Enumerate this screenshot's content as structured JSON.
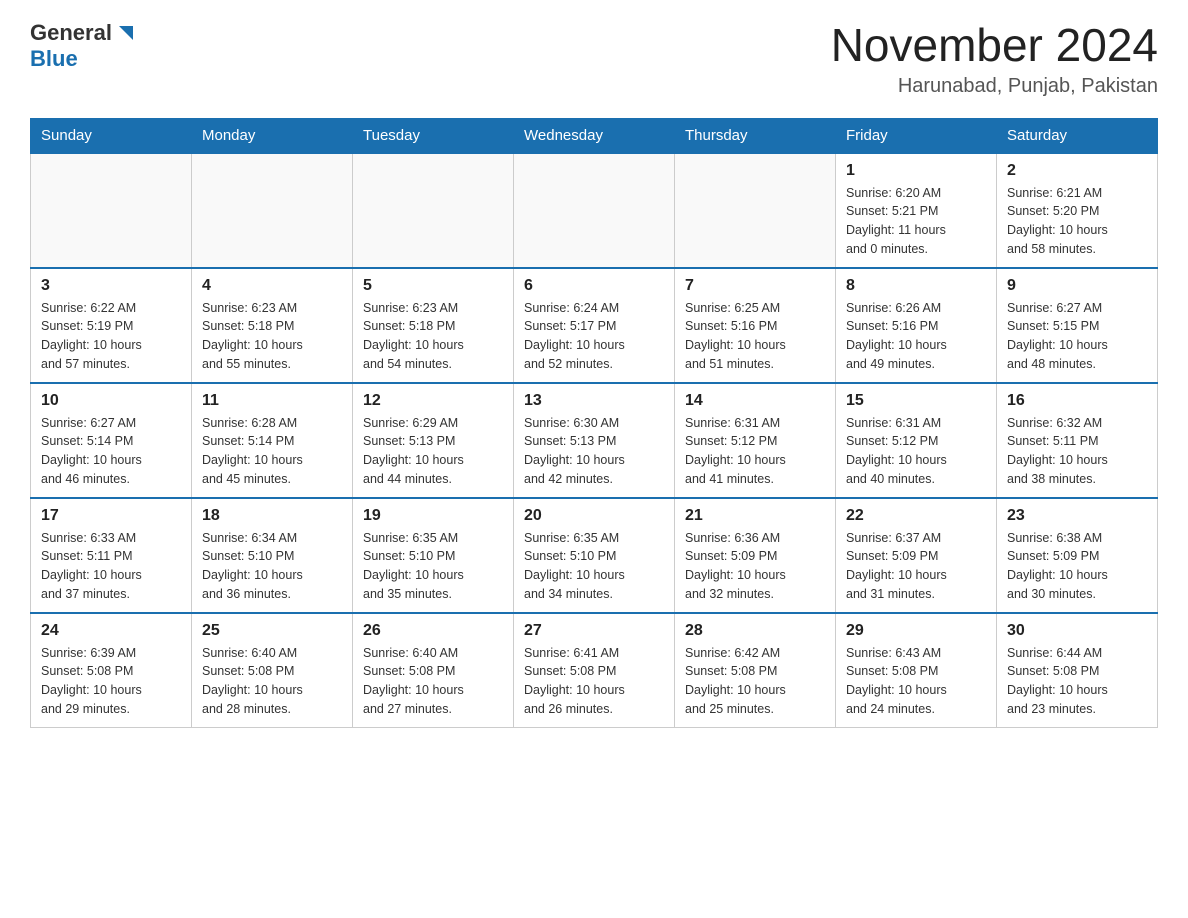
{
  "header": {
    "logo_general": "General",
    "logo_blue": "Blue",
    "month_title": "November 2024",
    "location": "Harunabad, Punjab, Pakistan"
  },
  "days_of_week": [
    "Sunday",
    "Monday",
    "Tuesday",
    "Wednesday",
    "Thursday",
    "Friday",
    "Saturday"
  ],
  "weeks": [
    [
      {
        "day": "",
        "info": ""
      },
      {
        "day": "",
        "info": ""
      },
      {
        "day": "",
        "info": ""
      },
      {
        "day": "",
        "info": ""
      },
      {
        "day": "",
        "info": ""
      },
      {
        "day": "1",
        "info": "Sunrise: 6:20 AM\nSunset: 5:21 PM\nDaylight: 11 hours\nand 0 minutes."
      },
      {
        "day": "2",
        "info": "Sunrise: 6:21 AM\nSunset: 5:20 PM\nDaylight: 10 hours\nand 58 minutes."
      }
    ],
    [
      {
        "day": "3",
        "info": "Sunrise: 6:22 AM\nSunset: 5:19 PM\nDaylight: 10 hours\nand 57 minutes."
      },
      {
        "day": "4",
        "info": "Sunrise: 6:23 AM\nSunset: 5:18 PM\nDaylight: 10 hours\nand 55 minutes."
      },
      {
        "day": "5",
        "info": "Sunrise: 6:23 AM\nSunset: 5:18 PM\nDaylight: 10 hours\nand 54 minutes."
      },
      {
        "day": "6",
        "info": "Sunrise: 6:24 AM\nSunset: 5:17 PM\nDaylight: 10 hours\nand 52 minutes."
      },
      {
        "day": "7",
        "info": "Sunrise: 6:25 AM\nSunset: 5:16 PM\nDaylight: 10 hours\nand 51 minutes."
      },
      {
        "day": "8",
        "info": "Sunrise: 6:26 AM\nSunset: 5:16 PM\nDaylight: 10 hours\nand 49 minutes."
      },
      {
        "day": "9",
        "info": "Sunrise: 6:27 AM\nSunset: 5:15 PM\nDaylight: 10 hours\nand 48 minutes."
      }
    ],
    [
      {
        "day": "10",
        "info": "Sunrise: 6:27 AM\nSunset: 5:14 PM\nDaylight: 10 hours\nand 46 minutes."
      },
      {
        "day": "11",
        "info": "Sunrise: 6:28 AM\nSunset: 5:14 PM\nDaylight: 10 hours\nand 45 minutes."
      },
      {
        "day": "12",
        "info": "Sunrise: 6:29 AM\nSunset: 5:13 PM\nDaylight: 10 hours\nand 44 minutes."
      },
      {
        "day": "13",
        "info": "Sunrise: 6:30 AM\nSunset: 5:13 PM\nDaylight: 10 hours\nand 42 minutes."
      },
      {
        "day": "14",
        "info": "Sunrise: 6:31 AM\nSunset: 5:12 PM\nDaylight: 10 hours\nand 41 minutes."
      },
      {
        "day": "15",
        "info": "Sunrise: 6:31 AM\nSunset: 5:12 PM\nDaylight: 10 hours\nand 40 minutes."
      },
      {
        "day": "16",
        "info": "Sunrise: 6:32 AM\nSunset: 5:11 PM\nDaylight: 10 hours\nand 38 minutes."
      }
    ],
    [
      {
        "day": "17",
        "info": "Sunrise: 6:33 AM\nSunset: 5:11 PM\nDaylight: 10 hours\nand 37 minutes."
      },
      {
        "day": "18",
        "info": "Sunrise: 6:34 AM\nSunset: 5:10 PM\nDaylight: 10 hours\nand 36 minutes."
      },
      {
        "day": "19",
        "info": "Sunrise: 6:35 AM\nSunset: 5:10 PM\nDaylight: 10 hours\nand 35 minutes."
      },
      {
        "day": "20",
        "info": "Sunrise: 6:35 AM\nSunset: 5:10 PM\nDaylight: 10 hours\nand 34 minutes."
      },
      {
        "day": "21",
        "info": "Sunrise: 6:36 AM\nSunset: 5:09 PM\nDaylight: 10 hours\nand 32 minutes."
      },
      {
        "day": "22",
        "info": "Sunrise: 6:37 AM\nSunset: 5:09 PM\nDaylight: 10 hours\nand 31 minutes."
      },
      {
        "day": "23",
        "info": "Sunrise: 6:38 AM\nSunset: 5:09 PM\nDaylight: 10 hours\nand 30 minutes."
      }
    ],
    [
      {
        "day": "24",
        "info": "Sunrise: 6:39 AM\nSunset: 5:08 PM\nDaylight: 10 hours\nand 29 minutes."
      },
      {
        "day": "25",
        "info": "Sunrise: 6:40 AM\nSunset: 5:08 PM\nDaylight: 10 hours\nand 28 minutes."
      },
      {
        "day": "26",
        "info": "Sunrise: 6:40 AM\nSunset: 5:08 PM\nDaylight: 10 hours\nand 27 minutes."
      },
      {
        "day": "27",
        "info": "Sunrise: 6:41 AM\nSunset: 5:08 PM\nDaylight: 10 hours\nand 26 minutes."
      },
      {
        "day": "28",
        "info": "Sunrise: 6:42 AM\nSunset: 5:08 PM\nDaylight: 10 hours\nand 25 minutes."
      },
      {
        "day": "29",
        "info": "Sunrise: 6:43 AM\nSunset: 5:08 PM\nDaylight: 10 hours\nand 24 minutes."
      },
      {
        "day": "30",
        "info": "Sunrise: 6:44 AM\nSunset: 5:08 PM\nDaylight: 10 hours\nand 23 minutes."
      }
    ]
  ]
}
